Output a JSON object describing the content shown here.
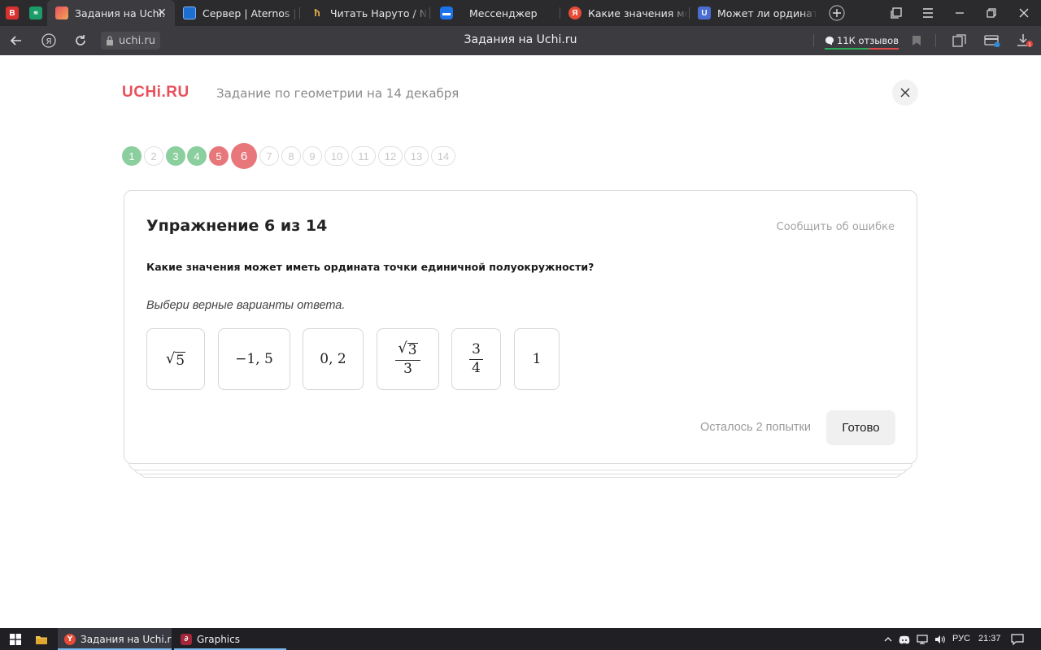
{
  "browser": {
    "tabs": [
      {
        "label": "",
        "favicon": "red-app-icon",
        "color": "#d8322f"
      },
      {
        "label": "",
        "favicon": "green-app-icon",
        "color": "#1c9c68"
      },
      {
        "label": "Задания на Uchi.ru",
        "favicon": "uchi-favicon",
        "active": true
      },
      {
        "label": "Сервер | Aternos | Бес",
        "favicon": "aternos-favicon"
      },
      {
        "label": "Читать Наруто / Naruto",
        "favicon": "manga-favicon"
      },
      {
        "label": "Мессенджер",
        "favicon": "messenger-favicon"
      },
      {
        "label": "Какие значения може",
        "favicon": "yandex-favicon"
      },
      {
        "label": "Может ли ордината т",
        "favicon": "u-favicon"
      }
    ],
    "address": {
      "url": "uchi.ru",
      "page_title": "Задания на Uchi.ru",
      "reviews": "11К отзывов"
    }
  },
  "page": {
    "logo": "UCHi.RU",
    "assignment_title": "Задание по геометрии на 14 декабря",
    "progress": [
      {
        "n": "1",
        "state": "correct"
      },
      {
        "n": "2",
        "state": "todo"
      },
      {
        "n": "3",
        "state": "correct"
      },
      {
        "n": "4",
        "state": "correct"
      },
      {
        "n": "5",
        "state": "wrong"
      },
      {
        "n": "6",
        "state": "current"
      },
      {
        "n": "7",
        "state": "todo"
      },
      {
        "n": "8",
        "state": "todo"
      },
      {
        "n": "9",
        "state": "todo"
      },
      {
        "n": "10",
        "state": "todo"
      },
      {
        "n": "11",
        "state": "todo"
      },
      {
        "n": "12",
        "state": "todo"
      },
      {
        "n": "13",
        "state": "todo"
      },
      {
        "n": "14",
        "state": "todo"
      }
    ],
    "exercise": {
      "title": "Упражнение 6 из 14",
      "report_link": "Сообщить об ошибке",
      "question": "Какие значения может иметь ордината точки единичной полуокружности?",
      "hint": "Выбери верные варианты ответа.",
      "options": {
        "sqrt5": {
          "radicand": "5"
        },
        "neg_one_five": "−1, 5",
        "zero_two": "0, 2",
        "sqrt3_over_3": {
          "radicand": "3",
          "den": "3"
        },
        "three_quarters": {
          "num": "3",
          "den": "4"
        },
        "one": "1"
      },
      "attempts_left": "Осталось 2 попытки",
      "submit_label": "Готово"
    }
  },
  "taskbar": {
    "apps": [
      {
        "label": "Задания на Uchi.ru ...",
        "active": true
      },
      {
        "label": "Graphics",
        "active": false
      }
    ],
    "language": "РУС",
    "time": "21:37"
  },
  "colors": {
    "brand": "#e8505b",
    "correct": "#8bcf9f",
    "wrong": "#e8777b"
  }
}
